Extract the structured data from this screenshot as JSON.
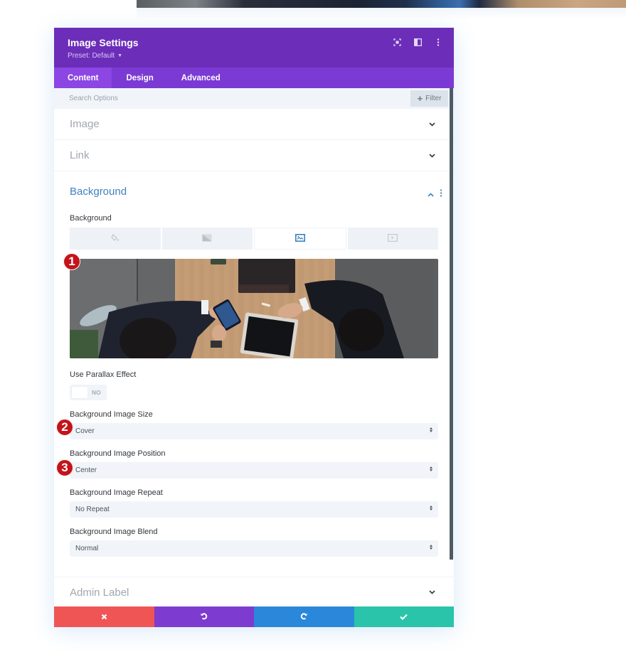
{
  "background_page": {
    "preview_strip": "partial image of business meeting"
  },
  "modal": {
    "title": "Image Settings",
    "preset_label": "Preset: Default",
    "header_icons": [
      "fullscreen-icon",
      "sidebar-layout-icon",
      "more-options-icon"
    ],
    "tabs": [
      {
        "label": "Content",
        "active": true
      },
      {
        "label": "Design",
        "active": false
      },
      {
        "label": "Advanced",
        "active": false
      }
    ],
    "search": {
      "placeholder": "Search Options",
      "value": ""
    },
    "filter_label": "Filter",
    "sections": {
      "image": {
        "title": "Image",
        "expanded": false
      },
      "link": {
        "title": "Link",
        "expanded": false
      },
      "background": {
        "title": "Background",
        "expanded": true,
        "field_label": "Background",
        "type_tabs": [
          {
            "name": "color",
            "icon": "paint-bucket-icon",
            "active": false
          },
          {
            "name": "gradient",
            "icon": "gradient-icon",
            "active": false
          },
          {
            "name": "image",
            "icon": "image-icon",
            "active": true
          },
          {
            "name": "video",
            "icon": "video-icon",
            "active": false
          }
        ],
        "image_preview": {
          "description": "Overhead view of two businessmen in suits at a wooden table using a smartphone and tablet"
        },
        "parallax": {
          "label": "Use Parallax Effect",
          "value": "NO"
        },
        "size": {
          "label": "Background Image Size",
          "value": "Cover"
        },
        "position": {
          "label": "Background Image Position",
          "value": "Center"
        },
        "repeat": {
          "label": "Background Image Repeat",
          "value": "No Repeat"
        },
        "blend": {
          "label": "Background Image Blend",
          "value": "Normal"
        }
      },
      "admin_label": {
        "title": "Admin Label",
        "expanded": false
      }
    },
    "annotations": [
      "1",
      "2",
      "3"
    ],
    "footer": {
      "cancel": {
        "icon": "close-icon",
        "color": "#ef5555"
      },
      "undo": {
        "icon": "undo-icon",
        "color": "#7e3bd0"
      },
      "redo": {
        "icon": "redo-icon",
        "color": "#2b87da"
      },
      "save": {
        "icon": "check-icon",
        "color": "#29c4a9"
      }
    },
    "colors": {
      "header": "#6c2eb9",
      "tabs_bar": "#7b3ad3",
      "active_tab": "#8c46e3",
      "section_accent": "#3d83bd",
      "annotation_badge": "#c4141a"
    }
  }
}
